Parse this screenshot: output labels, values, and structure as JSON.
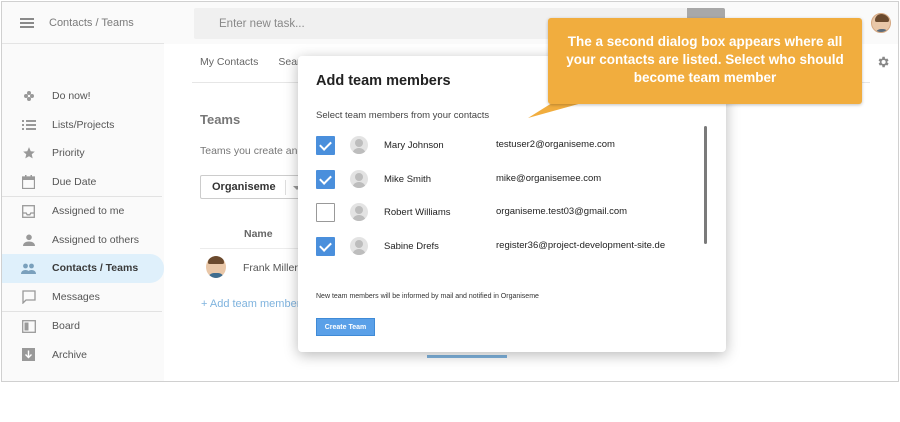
{
  "header": {
    "breadcrumb": "Contacts / Teams"
  },
  "task_input": {
    "placeholder": "Enter new task..."
  },
  "sidebar": {
    "items": [
      {
        "label": "Do now!",
        "icon": "gamepad-icon"
      },
      {
        "label": "Lists/Projects",
        "icon": "list-icon"
      },
      {
        "label": "Priority",
        "icon": "star-icon"
      },
      {
        "label": "Due Date",
        "icon": "calendar-icon"
      },
      {
        "label": "Assigned to me",
        "icon": "inbox-icon"
      },
      {
        "label": "Assigned to others",
        "icon": "person-icon"
      },
      {
        "label": "Contacts / Teams",
        "icon": "people-icon",
        "active": true
      },
      {
        "label": "Messages",
        "icon": "chat-icon"
      },
      {
        "label": "Board",
        "icon": "board-icon"
      },
      {
        "label": "Archive",
        "icon": "archive-icon"
      }
    ]
  },
  "main": {
    "tabs": [
      "My Contacts",
      "Searc"
    ],
    "teams_title": "Teams",
    "teams_desc": "Teams you create and",
    "team_select": "Organiseme",
    "col_name": "Name",
    "member_name": "Frank Millerr",
    "add_link": "+ Add team member"
  },
  "dialog": {
    "title": "Add team members",
    "subtitle": "Select team members from your contacts",
    "contacts": [
      {
        "name": "Mary Johnson",
        "email": "testuser2@organiseme.com",
        "checked": true
      },
      {
        "name": "Mike Smith",
        "email": "mike@organisemee.com",
        "checked": true
      },
      {
        "name": "Robert Williams",
        "email": "organiseme.test03@gmail.com",
        "checked": false
      },
      {
        "name": "Sabine Drefs",
        "email": "register36@project-development-site.de",
        "checked": true
      }
    ],
    "note": "New team members will be informed by mail and notified in Organiseme",
    "create_button": "Create Team"
  },
  "callout": {
    "text": "The a second dialog box appears where all your contacts are listed. Select who should become team member"
  },
  "colors": {
    "accent": "#4a8fdc",
    "callout": "#f1ad3e",
    "active_nav": "#dff0fb"
  }
}
